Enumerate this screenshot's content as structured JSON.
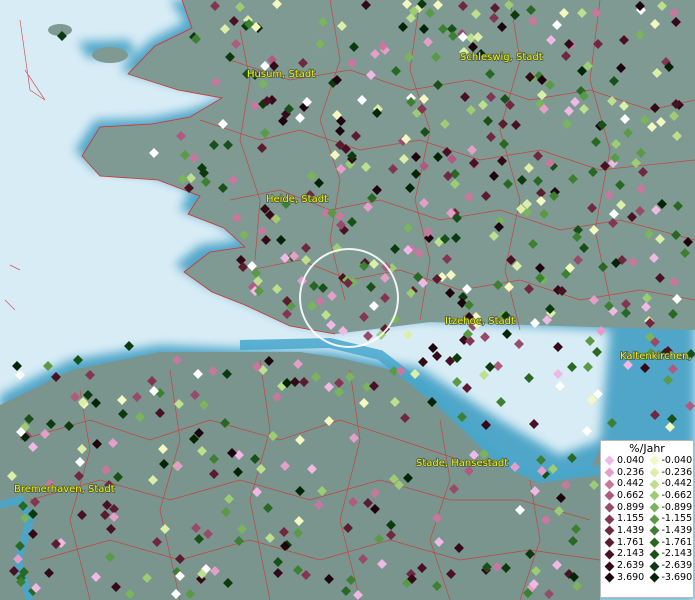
{
  "map": {
    "cities": [
      {
        "name": "Husum, Stadt"
      },
      {
        "name": "Schleswig, Stadt"
      },
      {
        "name": "Heide, Stadt"
      },
      {
        "name": "Itzehoe, Stadt"
      },
      {
        "name": "Kaltenkirchen, S"
      },
      {
        "name": "Stade, Hansestadt"
      },
      {
        "name": "Bremerhaven, Stadt"
      }
    ],
    "colors": {
      "sea": "#d8ecf6",
      "coast": "#4ba3c4",
      "land": "#7f9a92",
      "borders": "#d43030",
      "selection_circle": "#ffffff"
    }
  },
  "legend": {
    "title": "%/Jahr",
    "positive": [
      {
        "label": "0.040",
        "color": "#f0b8e4"
      },
      {
        "label": "0.236",
        "color": "#e49ec8"
      },
      {
        "label": "0.442",
        "color": "#c8789f"
      },
      {
        "label": "0.662",
        "color": "#b05a80"
      },
      {
        "label": "0.899",
        "color": "#984a6a"
      },
      {
        "label": "1.155",
        "color": "#843552"
      },
      {
        "label": "1.439",
        "color": "#702840"
      },
      {
        "label": "1.761",
        "color": "#5c1c30"
      },
      {
        "label": "2.143",
        "color": "#481224"
      },
      {
        "label": "2.639",
        "color": "#340a18"
      },
      {
        "label": "3.690",
        "color": "#1e040c"
      }
    ],
    "negative": [
      {
        "label": "-0.040",
        "color": "#f2f8c0"
      },
      {
        "label": "-0.236",
        "color": "#dcefa8"
      },
      {
        "label": "-0.442",
        "color": "#bee08e"
      },
      {
        "label": "-0.662",
        "color": "#9ccc74"
      },
      {
        "label": "-0.899",
        "color": "#7ab45c"
      },
      {
        "label": "-1.155",
        "color": "#5a9a46"
      },
      {
        "label": "-1.439",
        "color": "#3e8032"
      },
      {
        "label": "-1.761",
        "color": "#286824"
      },
      {
        "label": "-2.143",
        "color": "#185018"
      },
      {
        "label": "-2.639",
        "color": "#0c3a0e"
      },
      {
        "label": "-3.690",
        "color": "#042406"
      }
    ]
  }
}
